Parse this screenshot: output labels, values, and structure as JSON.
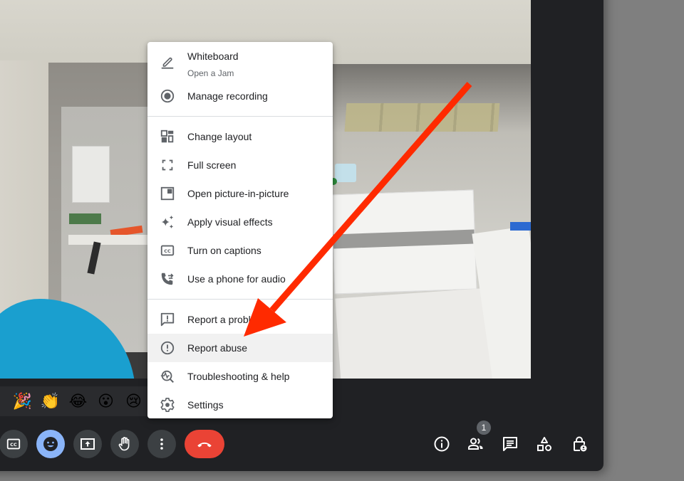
{
  "menu": {
    "items": [
      {
        "label": "Whiteboard",
        "sublabel": "Open a Jam",
        "icon": "pencil-icon"
      },
      {
        "label": "Manage recording",
        "icon": "record-icon"
      },
      {
        "label": "Change layout",
        "icon": "layout-icon"
      },
      {
        "label": "Full screen",
        "icon": "fullscreen-icon"
      },
      {
        "label": "Open picture-in-picture",
        "icon": "picture-in-picture-icon"
      },
      {
        "label": "Apply visual effects",
        "icon": "sparkle-icon"
      },
      {
        "label": "Turn on captions",
        "icon": "captions-icon"
      },
      {
        "label": "Use a phone for audio",
        "icon": "phone-forward-icon"
      },
      {
        "label": "Report a problem",
        "icon": "feedback-icon"
      },
      {
        "label": "Report abuse",
        "icon": "alert-circle-icon",
        "highlighted": true
      },
      {
        "label": "Troubleshooting & help",
        "icon": "troubleshoot-icon"
      },
      {
        "label": "Settings",
        "icon": "gear-icon"
      }
    ]
  },
  "reactions": [
    "🎉",
    "👏",
    "😂",
    "😮",
    "😢"
  ],
  "controls": {
    "captions": "captions-icon",
    "emoji": "emoji-icon",
    "present": "present-screen-icon",
    "raise_hand": "raise-hand-icon",
    "more": "more-vert-icon",
    "end_call": "end-call-icon"
  },
  "right_controls": {
    "people_count": "1"
  },
  "annotation": {
    "arrow_color": "#ff2a00"
  },
  "colors": {
    "end_call": "#ea4335",
    "active_button": "#8ab4f8",
    "bar_bg": "#202124"
  }
}
